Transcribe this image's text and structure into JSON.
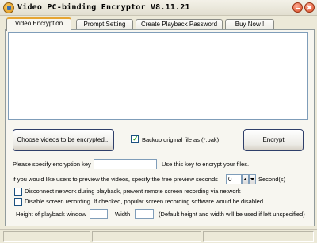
{
  "window": {
    "title": "Video PC-binding Encryptor V8.11.21"
  },
  "tabs": [
    {
      "label": "Video Encryption",
      "active": true
    },
    {
      "label": "Prompt Setting",
      "active": false
    },
    {
      "label": "Create Playback Password",
      "active": false
    },
    {
      "label": "Buy Now !",
      "active": false
    }
  ],
  "actions": {
    "choose_label": "Choose videos to be encrypted...",
    "backup_label": "Backup original file as (*.bak)",
    "backup_checked": true,
    "encrypt_label": "Encrypt"
  },
  "settings": {
    "key_label": "Please specify encryption key",
    "key_value": "",
    "key_hint": "Use this key to encrypt your files.",
    "preview_label": "if you would like users to preview the videos, specify the free preview seconds",
    "preview_value": "0",
    "seconds_label": "Second(s)",
    "disconnect_label": "Disconnect network during playback, prevent remote screen recording via network",
    "disconnect_checked": false,
    "disable_label": "Disable screen recording. If checked, popular screen recording software would be disabled.",
    "disable_checked": false,
    "height_label": "Height of playback window",
    "height_value": "",
    "width_label": "Width",
    "width_value": "",
    "size_note": "(Default height and width will be used if left unspecified)"
  },
  "icons": {
    "app": "app-logo-icon",
    "minimize": "minimize-icon",
    "close": "close-icon",
    "spin_up": "arrow-up-icon",
    "spin_down": "arrow-down-icon"
  }
}
